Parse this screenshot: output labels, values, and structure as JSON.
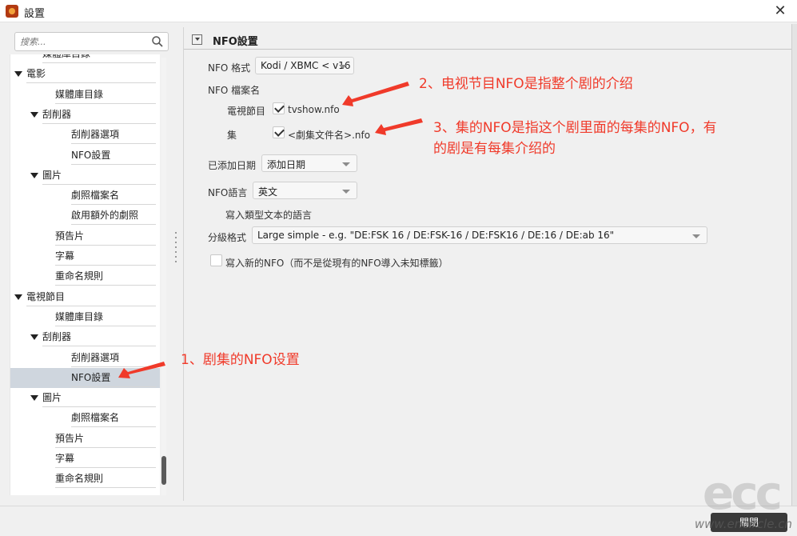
{
  "window": {
    "title": "設置",
    "close_symbol": "✕"
  },
  "search": {
    "placeholder": "搜索..."
  },
  "tree": [
    {
      "label": "媒體庫目錄",
      "level": 1,
      "caret": false,
      "selected": false
    },
    {
      "label": "電影",
      "level": 0,
      "caret": true,
      "selected": false
    },
    {
      "label": "媒體庫目錄",
      "level": 2,
      "caret": false,
      "selected": false
    },
    {
      "label": "刮削器",
      "level": 1,
      "caret": true,
      "selected": false
    },
    {
      "label": "刮削器選項",
      "level": 3,
      "caret": false,
      "selected": false
    },
    {
      "label": "NFO設置",
      "level": 3,
      "caret": false,
      "selected": false
    },
    {
      "label": "圖片",
      "level": 1,
      "caret": true,
      "selected": false
    },
    {
      "label": "劇照檔案名",
      "level": 3,
      "caret": false,
      "selected": false
    },
    {
      "label": "啟用額外的劇照",
      "level": 3,
      "caret": false,
      "selected": false
    },
    {
      "label": "預告片",
      "level": 2,
      "caret": false,
      "selected": false
    },
    {
      "label": "字幕",
      "level": 2,
      "caret": false,
      "selected": false
    },
    {
      "label": "重命名規則",
      "level": 2,
      "caret": false,
      "selected": false
    },
    {
      "label": "電視節目",
      "level": 0,
      "caret": true,
      "selected": false
    },
    {
      "label": "媒體庫目錄",
      "level": 2,
      "caret": false,
      "selected": false
    },
    {
      "label": "刮削器",
      "level": 1,
      "caret": true,
      "selected": false
    },
    {
      "label": "刮削器選項",
      "level": 3,
      "caret": false,
      "selected": false
    },
    {
      "label": "NFO設置",
      "level": 3,
      "caret": false,
      "selected": true
    },
    {
      "label": "圖片",
      "level": 1,
      "caret": true,
      "selected": false
    },
    {
      "label": "劇照檔案名",
      "level": 3,
      "caret": false,
      "selected": false
    },
    {
      "label": "預告片",
      "level": 2,
      "caret": false,
      "selected": false
    },
    {
      "label": "字幕",
      "level": 2,
      "caret": false,
      "selected": false
    },
    {
      "label": "重命名規則",
      "level": 2,
      "caret": false,
      "selected": false
    }
  ],
  "section": {
    "title": "NFO設置"
  },
  "form": {
    "nfo_format_label": "NFO 格式",
    "nfo_format_value": "Kodi / XBMC < v16",
    "nfo_filename_label": "NFO 檔案名",
    "tvshow_label": "電視節目",
    "tvshow_value": "tvshow.nfo",
    "episode_label": "集",
    "episode_value": "<劇集文件名>.nfo",
    "date_added_label": "已添加日期",
    "date_added_value": "添加日期",
    "nfo_language_label": "NFO語言",
    "nfo_language_value": "英文",
    "language_note": "寫入類型文本的語言",
    "rating_format_label": "分級格式",
    "rating_format_value": "Large simple - e.g. \"DE:FSK 16 / DE:FSK-16 / DE:FSK16 / DE:16 / DE:ab 16\"",
    "write_new_nfo_label": "寫入新的NFO（而不是從現有的NFO導入未知標籤）"
  },
  "annotations": {
    "a1": "1、剧集的NFO设置",
    "a2": "2、电视节目NFO是指整个剧的介绍",
    "a3_line1": "3、集的NFO是指这个剧里面的每集的NFO，有",
    "a3_line2": "的剧是有每集介绍的"
  },
  "footer": {
    "close_label": "關閉"
  },
  "watermark": {
    "logo": "ecc",
    "url": "www.encircle.cn"
  },
  "colors": {
    "annotation": "#f03a2a",
    "selected_row": "#cfd6de"
  }
}
